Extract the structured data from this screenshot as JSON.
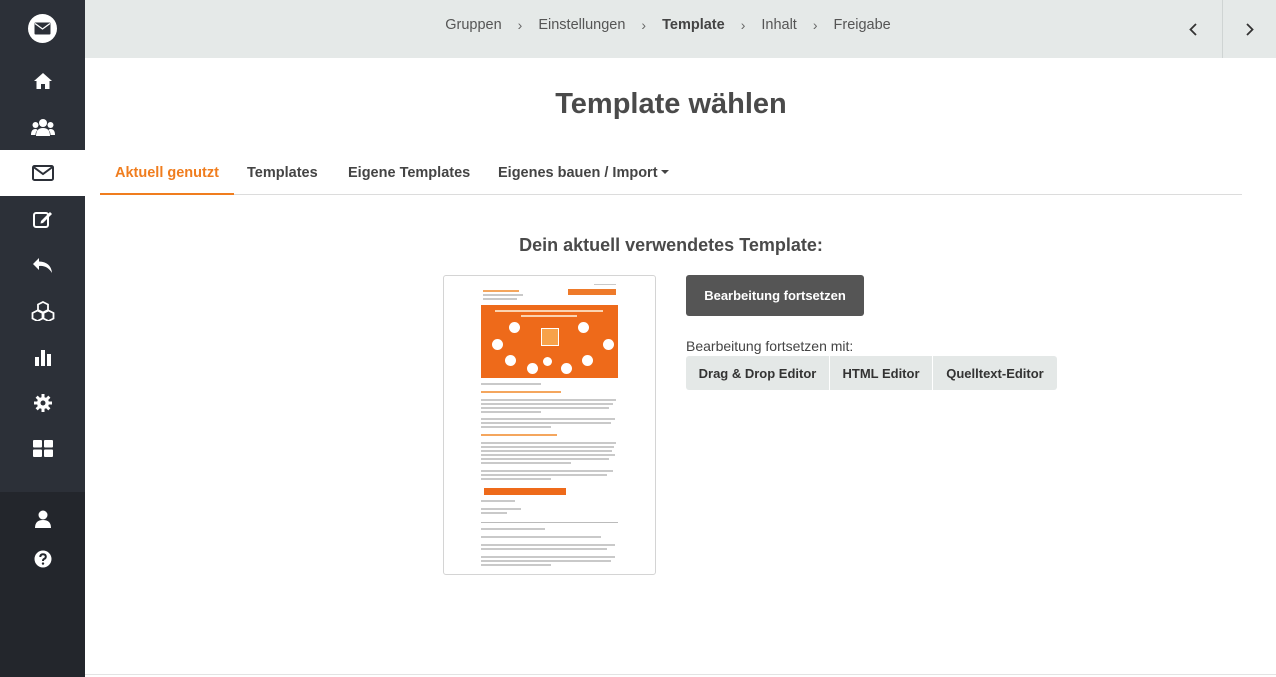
{
  "breadcrumb": {
    "steps": [
      {
        "label": "Gruppen"
      },
      {
        "label": "Einstellungen"
      },
      {
        "label": "Template"
      },
      {
        "label": "Inhalt"
      },
      {
        "label": "Freigabe"
      }
    ],
    "current_step": "Template"
  },
  "page": {
    "title": "Template wählen",
    "subtitle": "Dein aktuell verwendetes Template:"
  },
  "tabs": [
    {
      "label": "Aktuell genutzt",
      "active": true
    },
    {
      "label": "Templates",
      "active": false
    },
    {
      "label": "Eigene Templates",
      "active": false
    },
    {
      "label": "Eigenes bauen / Import",
      "active": false,
      "dropdown": true
    }
  ],
  "actions": {
    "primary_label": "Bearbeitung fortsetzen",
    "continue_with_label": "Bearbeitung fortsetzen mit:",
    "editors": [
      {
        "label": "Drag & Drop Editor"
      },
      {
        "label": "HTML Editor"
      },
      {
        "label": "Quelltext-Editor"
      }
    ]
  },
  "sidebar": {
    "items": [
      {
        "icon": "home-icon"
      },
      {
        "icon": "users-icon"
      },
      {
        "icon": "mail-icon",
        "active": true
      },
      {
        "icon": "edit-icon"
      },
      {
        "icon": "reply-icon"
      },
      {
        "icon": "cubes-icon"
      },
      {
        "icon": "bar-chart-icon"
      },
      {
        "icon": "gear-icon"
      },
      {
        "icon": "dashboard-icon"
      },
      {
        "icon": "user-icon"
      },
      {
        "icon": "help-icon"
      }
    ]
  },
  "colors": {
    "accent": "#f07d1e",
    "sidebar_bg": "#2c3038",
    "topbar_bg": "#e5e9e8",
    "primary_button": "#555555"
  }
}
